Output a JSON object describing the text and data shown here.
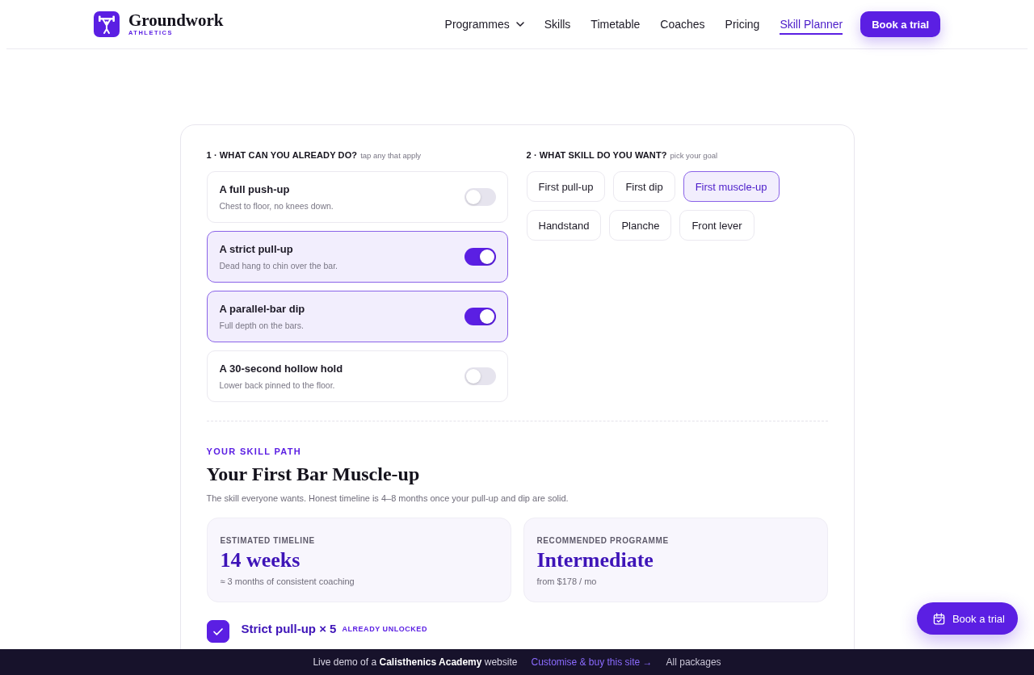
{
  "header": {
    "logo": {
      "name": "Groundwork",
      "tagline": "ATHLETICS"
    },
    "nav": [
      {
        "label": "Programmes",
        "kind": "dropdown",
        "selected": false
      },
      {
        "label": "Skills",
        "kind": "link",
        "selected": false
      },
      {
        "label": "Timetable",
        "kind": "link",
        "selected": false
      },
      {
        "label": "Coaches",
        "kind": "link",
        "selected": false
      },
      {
        "label": "Pricing",
        "kind": "link",
        "selected": false
      },
      {
        "label": "Skill Planner",
        "kind": "link",
        "selected": true
      }
    ],
    "cta": "Book a trial"
  },
  "planner": {
    "abilities": {
      "step": "1 · WHAT CAN YOU ALREADY DO?",
      "hint": "tap any that apply",
      "items": [
        {
          "title": "A full push-up",
          "description": "Chest to floor, no knees down.",
          "on": false
        },
        {
          "title": "A strict pull-up",
          "description": "Dead hang to chin over the bar.",
          "on": true
        },
        {
          "title": "A parallel-bar dip",
          "description": "Full depth on the bars.",
          "on": true
        },
        {
          "title": "A 30-second hollow hold",
          "description": "Lower back pinned to the floor.",
          "on": false
        }
      ]
    },
    "goals": {
      "step": "2 · WHAT SKILL DO YOU WANT?",
      "hint": "pick your goal",
      "options": [
        {
          "label": "First pull-up",
          "selected": false
        },
        {
          "label": "First dip",
          "selected": false
        },
        {
          "label": "First muscle-up",
          "selected": true
        },
        {
          "label": "Handstand",
          "selected": false
        },
        {
          "label": "Planche",
          "selected": false
        },
        {
          "label": "Front lever",
          "selected": false
        }
      ]
    },
    "path": {
      "eyebrow": "YOUR SKILL PATH",
      "title": "Your First Bar Muscle-up",
      "description": "The skill everyone wants. Honest timeline is 4–8 months once your pull-up and dip are solid.",
      "stats": [
        {
          "label": "ESTIMATED TIMELINE",
          "value": "14 weeks",
          "note": "≈ 3 months of consistent coaching"
        },
        {
          "label": "RECOMMENDED PROGRAMME",
          "value": "Intermediate",
          "note": "from $178 / mo"
        }
      ],
      "milestones": [
        {
          "title": "Strict pull-up × 5",
          "tag": "ALREADY UNLOCKED",
          "checked": true
        }
      ]
    }
  },
  "floating_button": {
    "label": "Book a trial"
  },
  "demo_bar": {
    "text": "Live demo of a **Calisthenics Academy** website",
    "link": "Customise & buy this site →",
    "secondary": "All packages"
  }
}
